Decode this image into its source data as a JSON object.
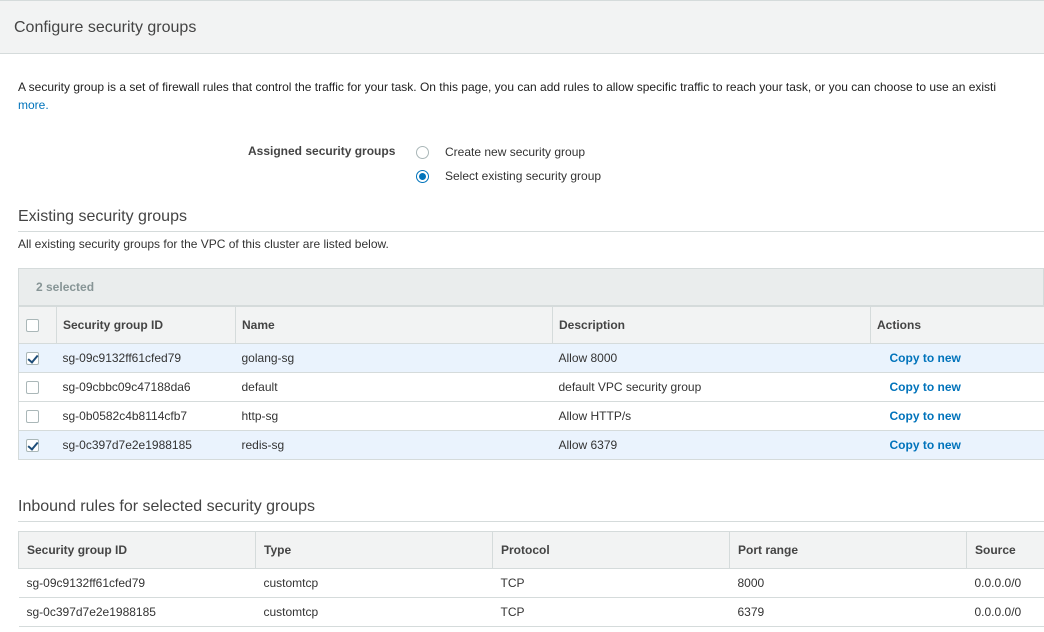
{
  "header": {
    "title": "Configure security groups"
  },
  "intro": {
    "text": "A security group is a set of firewall rules that control the traffic for your task. On this page, you can add rules to allow specific traffic to reach your task, or you can choose to use an existi",
    "more_link": "more."
  },
  "assigned": {
    "label": "Assigned security groups",
    "options": [
      {
        "label": "Create new security group",
        "selected": false
      },
      {
        "label": "Select existing security group",
        "selected": true
      }
    ]
  },
  "existing": {
    "title": "Existing security groups",
    "subtitle": "All existing security groups for the VPC of this cluster are listed below.",
    "selected_count": "2 selected",
    "columns": [
      "Security group ID",
      "Name",
      "Description",
      "Actions"
    ],
    "rows": [
      {
        "id": "sg-09c9132ff61cfed79",
        "name": "golang-sg",
        "description": "Allow 8000",
        "action": "Copy to new",
        "checked": true
      },
      {
        "id": "sg-09cbbc09c47188da6",
        "name": "default",
        "description": "default VPC security group",
        "action": "Copy to new",
        "checked": false
      },
      {
        "id": "sg-0b0582c4b8114cfb7",
        "name": "http-sg",
        "description": "Allow HTTP/s",
        "action": "Copy to new",
        "checked": false
      },
      {
        "id": "sg-0c397d7e2e1988185",
        "name": "redis-sg",
        "description": "Allow 6379",
        "action": "Copy to new",
        "checked": true
      }
    ]
  },
  "inbound": {
    "title": "Inbound rules for selected security groups",
    "columns": [
      "Security group ID",
      "Type",
      "Protocol",
      "Port range",
      "Source"
    ],
    "rows": [
      {
        "id": "sg-09c9132ff61cfed79",
        "type": "customtcp",
        "protocol": "TCP",
        "port": "8000",
        "source": "0.0.0.0/0"
      },
      {
        "id": "sg-0c397d7e2e1988185",
        "type": "customtcp",
        "protocol": "TCP",
        "port": "6379",
        "source": "0.0.0.0/0"
      }
    ]
  },
  "colors": {
    "accent": "#0073bb",
    "selected_row": "#eaf3fd",
    "header_bg": "#f2f3f3"
  }
}
